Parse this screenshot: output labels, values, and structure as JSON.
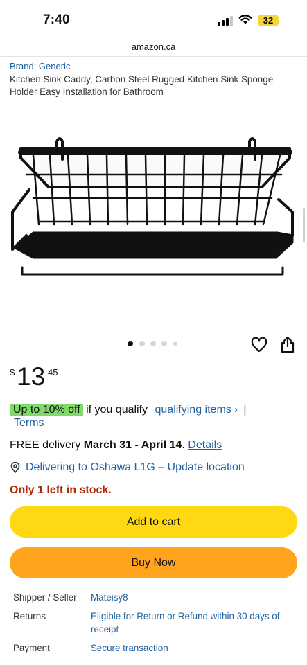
{
  "status_bar": {
    "time": "7:40",
    "battery": "32"
  },
  "browser": {
    "url": "amazon.ca"
  },
  "product": {
    "brand": "Brand: Generic",
    "title": "Kitchen Sink Caddy, Carbon Steel Rugged Kitchen Sink Sponge Holder Easy Installation for Bathroom",
    "image_alt": "black metal wire sink caddy",
    "carousel": {
      "count": 5,
      "active_index": 0
    }
  },
  "price": {
    "currency": "$",
    "whole": "13",
    "fraction": "45"
  },
  "promo": {
    "badge": "Up to 10% off",
    "text": "if you qualify",
    "link": "qualifying items",
    "link_chevron": "›",
    "separator": "|",
    "terms": "Terms"
  },
  "delivery": {
    "prefix": "FREE delivery",
    "dates": "March 31 - April 14",
    "suffix": ".",
    "details_link": "Details"
  },
  "location": {
    "text": "Delivering to Oshawa L1G – Update location"
  },
  "stock": "Only 1 left in stock.",
  "buttons": {
    "add_to_cart": "Add to cart",
    "buy_now": "Buy Now"
  },
  "info": {
    "shipper_label": "Shipper / Seller",
    "shipper_value": "Mateisy8",
    "returns_label": "Returns",
    "returns_value": "Eligible for Return or Refund within 30 days of receipt",
    "payment_label": "Payment",
    "payment_value": "Secure transaction"
  },
  "colors": {
    "link": "#2162a1",
    "stock": "#b12704",
    "promo_badge": "#7fda69",
    "add_to_cart": "#ffd814",
    "buy_now": "#ffa41c",
    "battery": "#f4d53a"
  },
  "icons": {
    "heart": "heart-icon",
    "share": "share-icon",
    "location": "location-pin-icon",
    "signal": "cellular-signal-icon",
    "wifi": "wifi-icon"
  }
}
